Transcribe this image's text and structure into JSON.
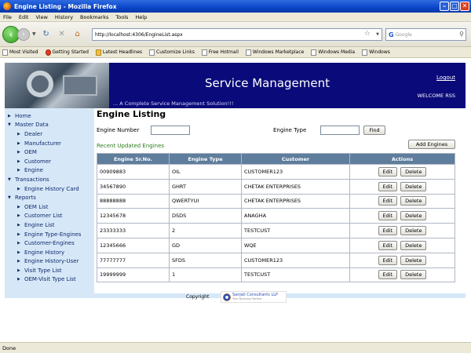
{
  "window": {
    "title": "Engine Listing - Mozilla Firefox"
  },
  "menu": [
    "File",
    "Edit",
    "View",
    "History",
    "Bookmarks",
    "Tools",
    "Help"
  ],
  "nav": {
    "url": "http://localhost:4306/EngineList.aspx",
    "search_placeholder": "Google"
  },
  "bookmarks": [
    "Most Visited",
    "Getting Started",
    "Latest Headlines",
    "Customize Links",
    "Free Hotmail",
    "Windows Marketplace",
    "Windows Media",
    "Windows"
  ],
  "header": {
    "title": "Service Management",
    "tagline": "... A Complete Service Management Solution!!!",
    "logout": "Logout",
    "welcome": "WELCOME RSS"
  },
  "sidebar": [
    {
      "label": "Home",
      "level": 1,
      "expanded": false
    },
    {
      "label": "Master Data",
      "level": 1,
      "expanded": true
    },
    {
      "label": "Dealer",
      "level": 2,
      "expanded": false
    },
    {
      "label": "Manufacturer",
      "level": 2,
      "expanded": false
    },
    {
      "label": "OEM",
      "level": 2,
      "expanded": false
    },
    {
      "label": "Customer",
      "level": 2,
      "expanded": false
    },
    {
      "label": "Engine",
      "level": 2,
      "expanded": false
    },
    {
      "label": "Transactions",
      "level": 1,
      "expanded": true
    },
    {
      "label": "Engine History Card",
      "level": 2,
      "expanded": false
    },
    {
      "label": "Reports",
      "level": 1,
      "expanded": true
    },
    {
      "label": "OEM List",
      "level": 2,
      "expanded": false
    },
    {
      "label": "Customer List",
      "level": 2,
      "expanded": false
    },
    {
      "label": "Engine List",
      "level": 2,
      "expanded": false
    },
    {
      "label": "Engine Type-Engines",
      "level": 2,
      "expanded": false
    },
    {
      "label": "Customer-Engines",
      "level": 2,
      "expanded": false
    },
    {
      "label": "Engine History",
      "level": 2,
      "expanded": false
    },
    {
      "label": "Engine History-User",
      "level": 2,
      "expanded": false
    },
    {
      "label": "Visit Type List",
      "level": 2,
      "expanded": false
    },
    {
      "label": "OEM-Visit Type List",
      "level": 2,
      "expanded": false
    }
  ],
  "main": {
    "page_title": "Engine Listing",
    "engine_number_label": "Engine Number",
    "engine_number_value": "",
    "engine_type_label": "Engine Type",
    "engine_type_value": "",
    "find_button": "Find",
    "add_button": "Add Engines",
    "recent_label": "Recent Updated Engines"
  },
  "table": {
    "columns": [
      "Engine Sr.No.",
      "Engine Type",
      "Customer",
      "Actions"
    ],
    "edit_label": "Edit",
    "delete_label": "Delete",
    "rows": [
      [
        "00909883",
        "OIL",
        "CUSTOMER123"
      ],
      [
        "34567890",
        "GHRT",
        "CHETAK ENTERPRISES"
      ],
      [
        "88888888",
        "QWERTYUI",
        "CHETAK ENTERPRISES"
      ],
      [
        "12345678",
        "DSDS",
        "ANAGHA"
      ],
      [
        "23333333",
        "2",
        "TESTCUST"
      ],
      [
        "12345666",
        "GD",
        "WQE"
      ],
      [
        "77777777",
        "SFDS",
        "CUSTOMER123"
      ],
      [
        "19999999",
        "1",
        "TESTCUST"
      ]
    ]
  },
  "footer": {
    "copyright": "Copyright",
    "logo_name": "Sanjali Consultants LLP",
    "logo_tagline": "Your Business Partner"
  },
  "status": "Done",
  "colors": {
    "header_bg": "#0a0a7a",
    "sidebar_bg": "#d6e8f8",
    "table_header": "#5f7d9c",
    "recent_text": "#2e7d1e"
  }
}
